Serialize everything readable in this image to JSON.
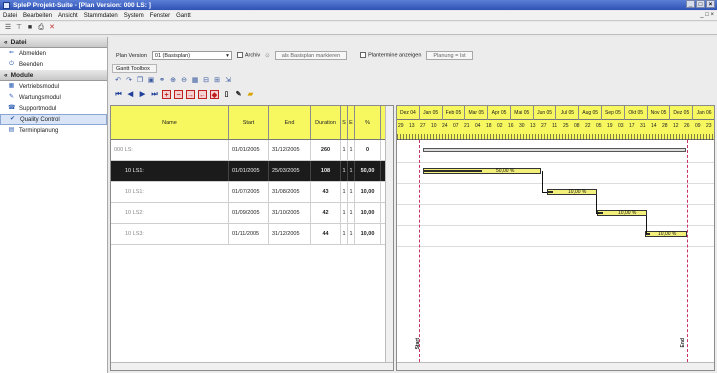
{
  "window": {
    "title": "SpleP Projekt-Suite - [Plan Version: 000 LS: ]",
    "controls": [
      "_",
      "□",
      "×"
    ]
  },
  "menu": [
    "Datei",
    "Bearbeiten",
    "Ansicht",
    "Stammdaten",
    "System",
    "Fenster",
    "Gantt"
  ],
  "sidebar": {
    "sections": [
      {
        "label": "Datei",
        "items": [
          {
            "label": "Abmelden",
            "icon": "logout-icon"
          },
          {
            "label": "Beenden",
            "icon": "exit-icon"
          }
        ]
      },
      {
        "label": "Module",
        "items": [
          {
            "label": "Vertriebsmodul",
            "icon": "sales-icon"
          },
          {
            "label": "Wartungsmodul",
            "icon": "wrench-icon"
          },
          {
            "label": "Supportmodul",
            "icon": "support-icon"
          },
          {
            "label": "Quality Control",
            "icon": "quality-icon",
            "selected": true
          },
          {
            "label": "Terminplanung",
            "icon": "calendar-icon"
          }
        ]
      }
    ]
  },
  "planbar": {
    "plan_version_label": "Plan Version",
    "plan_version_value": "01 (Basisplan)",
    "archiv_label": "Archiv",
    "basisplan_button": "als Basisplan markieren",
    "plantermine_label": "Plantermine anzeigen",
    "planung_button": "Planung = Ist"
  },
  "gantt_toolbox_label": "Gantt Toolbox",
  "grid": {
    "headers": {
      "name": "Name",
      "start": "Start",
      "end": "End",
      "duration": "Duration",
      "s": "S",
      "e": "E",
      "pct": "%"
    },
    "rows": [
      {
        "name": "000 LS:",
        "start": "01/01/2005",
        "end": "31/12/2005",
        "duration": "260",
        "s": "1",
        "e": "1",
        "pct": "0"
      },
      {
        "name": "10 LS1:",
        "start": "01/01/2005",
        "end": "25/03/2005",
        "duration": "108",
        "s": "1",
        "e": "1",
        "pct": "50,00"
      },
      {
        "name": "10 LS1:",
        "start": "01/07/2005",
        "end": "31/08/2005",
        "duration": "43",
        "s": "1",
        "e": "1",
        "pct": "10,00"
      },
      {
        "name": "10 LS2:",
        "start": "01/09/2005",
        "end": "31/10/2005",
        "duration": "42",
        "s": "1",
        "e": "1",
        "pct": "10,00"
      },
      {
        "name": "10 LS3:",
        "start": "01/11/2005",
        "end": "31/12/2005",
        "duration": "44",
        "s": "1",
        "e": "1",
        "pct": "10,00"
      }
    ]
  },
  "timeline": {
    "months": [
      "Dez 04",
      "Jan 05",
      "Feb 05",
      "Mar 05",
      "Apr 05",
      "Mai 05",
      "Jun 05",
      "Jul 05",
      "Aug 05",
      "Sep 05",
      "Okt 05",
      "Nov 05",
      "Dez 05",
      "Jan 06"
    ],
    "days": [
      "29",
      "13",
      "27",
      "10",
      "24",
      "07",
      "21",
      "04",
      "18",
      "02",
      "16",
      "30",
      "13",
      "27",
      "11",
      "25",
      "08",
      "22",
      "05",
      "19",
      "03",
      "17",
      "31",
      "14",
      "28",
      "12",
      "26",
      "09",
      "23"
    ],
    "bars": [
      {
        "label": "50,00 %",
        "progress": 0.5
      },
      {
        "label": "10,00 %",
        "progress": 0.1
      },
      {
        "label": "10,00 %",
        "progress": 0.1
      },
      {
        "label": "10,00 %",
        "progress": 0.1
      }
    ],
    "start_flag": "Start",
    "end_flag": "End"
  },
  "colors": {
    "header_yellow": "#f7f75f",
    "bar_yellow": "#f2ef7a",
    "titlebar": "#2f52b5",
    "marker": "#c8326a"
  }
}
